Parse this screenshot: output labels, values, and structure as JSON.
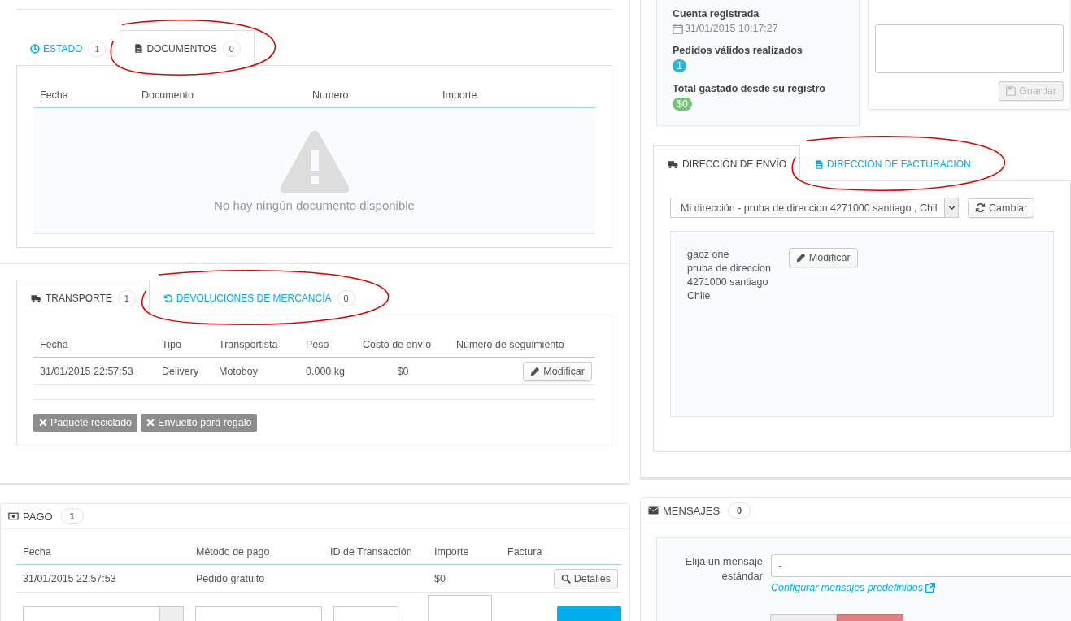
{
  "order_tabs": [
    {
      "label": "ESTADO",
      "count": "1",
      "selected": false,
      "circled": false
    },
    {
      "label": "DOCUMENTOS",
      "count": "0",
      "selected": true,
      "circled": true
    }
  ],
  "documents_table": {
    "columns": [
      "Fecha",
      "Documento",
      "Numero",
      "Importe"
    ],
    "empty_message": "No hay ningún documento disponible"
  },
  "shipping_tabs": [
    {
      "label": "TRANSPORTE",
      "count": "1",
      "selected": true,
      "circled": false
    },
    {
      "label": "DEVOLUCIONES DE MERCANCÍA",
      "count": "0",
      "selected": false,
      "circled": true
    }
  ],
  "shipping_table": {
    "columns": [
      "Fecha",
      "Tipo",
      "Transportista",
      "Peso",
      "Costo de envío",
      "Número de seguimiento"
    ],
    "rows": [
      {
        "cells": [
          "31/01/2015 22:57:53",
          "Delivery",
          "Motoboy",
          "0.000 kg",
          "$0"
        ],
        "action": "Modificar"
      }
    ]
  },
  "shipping_options": [
    {
      "label": "Paquete reciclado",
      "checked": false
    },
    {
      "label": "Envuelto para regalo",
      "checked": false
    }
  ],
  "customer_stats": [
    {
      "label": "Cuenta registrada",
      "kind": "date",
      "value": "31/01/2015 10:17:27"
    },
    {
      "label": "Pedidos válidos realizados",
      "kind": "badge",
      "value": "1",
      "color": "#25b9d7"
    },
    {
      "label": "Total gastado desde su registro",
      "kind": "badge",
      "value": "$0",
      "color": "#72c279"
    }
  ],
  "note": {
    "button": "Guardar",
    "disabled": true
  },
  "address_tabs": [
    {
      "label": "DIRECCIÓN DE ENVÍO",
      "selected": true,
      "circled": false
    },
    {
      "label": "DIRECCIÓN DE FACTURACIÓN",
      "selected": false,
      "circled": true
    }
  ],
  "address": {
    "select_value": "Mi dirección - pruba de direccion 4271000 santiago , Chil",
    "change_button": "Cambiar",
    "lines": [
      "gaoz one",
      "pruba de direccion",
      "4271000 santiago",
      "Chile"
    ],
    "edit_button": "Modificar"
  },
  "payment": {
    "title": "PAGO",
    "count": "1",
    "columns": [
      "Fecha",
      "Método de pago",
      "ID de Transacción",
      "Importe",
      "Factura"
    ],
    "rows": [
      {
        "date": "31/01/2015 22:57:53",
        "method": "Pedido gratuito",
        "amount": "$0",
        "action": "Detalles"
      }
    ]
  },
  "messages": {
    "title": "MENSAJES",
    "count": "0",
    "label": "Elija un mensaje estándar",
    "select_value": "-",
    "link": "Configurar mensajes predefinidos",
    "toggle": [
      {
        "selected": false
      },
      {
        "selected": true
      }
    ]
  }
}
